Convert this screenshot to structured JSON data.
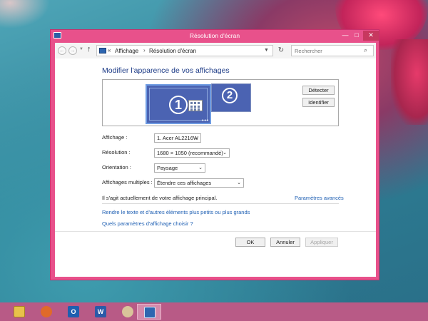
{
  "window": {
    "title": "Résolution d'écran",
    "controls": {
      "minimize": "—",
      "maximize": "□",
      "close": "✕"
    }
  },
  "address_bar": {
    "breadcrumb_overflow": "«",
    "crumb1": "Affichage",
    "separator": "›",
    "crumb2": "Résolution d'écran",
    "search_placeholder": "Rechercher"
  },
  "main": {
    "heading": "Modifier l'apparence de vos affichages",
    "monitor1_number": "1",
    "monitor2_number": "2",
    "detect_button": "Détecter",
    "identify_button": "Identifier",
    "settings": [
      {
        "label": "Affichage :",
        "value": "1. Acer AL2216W"
      },
      {
        "label": "Résolution :",
        "value": "1680 × 1050 (recommandé)"
      },
      {
        "label": "Orientation :",
        "value": "Paysage"
      },
      {
        "label": "Affichages multiples :",
        "value": "Étendre ces affichages"
      }
    ],
    "primary_note": "Il s'agit actuellement de votre affichage principal.",
    "advanced_link": "Paramètres avancés",
    "link_text_size": "Rendre le texte et d'autres éléments plus petits ou plus grands",
    "link_which_settings": "Quels paramètres d'affichage choisir ?"
  },
  "buttons": {
    "ok": "OK",
    "cancel": "Annuler",
    "apply": "Appliquer"
  },
  "taskbar": {
    "items": [
      {
        "name": "file-explorer-icon",
        "glyph": ""
      },
      {
        "name": "firefox-icon",
        "glyph": ""
      },
      {
        "name": "outlook-icon",
        "glyph": "O"
      },
      {
        "name": "word-icon",
        "glyph": "W"
      },
      {
        "name": "paint-icon",
        "glyph": ""
      },
      {
        "name": "display-settings-icon",
        "glyph": ""
      }
    ],
    "active_index": 5
  },
  "colors": {
    "window_frame": "#e8518b",
    "heading": "#1e3c87",
    "link": "#1e5fb3",
    "monitor_fill": "#4b63b2",
    "taskbar": "#b85a86"
  }
}
